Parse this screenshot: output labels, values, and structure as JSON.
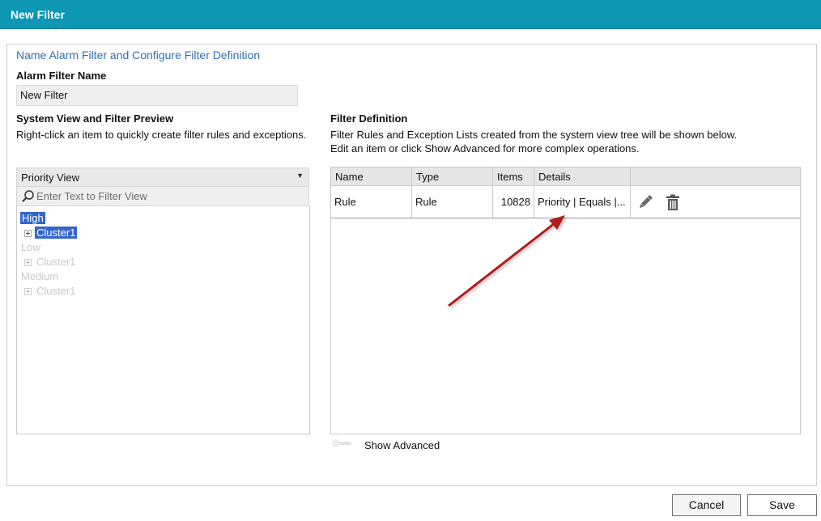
{
  "window": {
    "title": "New Filter"
  },
  "form": {
    "heading": "Name Alarm Filter and Configure Filter Definition",
    "name_label": "Alarm Filter Name",
    "name_value": "New Filter"
  },
  "system_view": {
    "title": "System View and Filter Preview",
    "hint": "Right-click an item to quickly create filter rules and exceptions.",
    "view_select": {
      "value": "Priority View"
    },
    "filter_placeholder": "Enter Text to Filter View",
    "tree": [
      {
        "label": "High",
        "selected": true,
        "dimmed": false
      },
      {
        "label": "Cluster1",
        "selected": true,
        "dimmed": false
      },
      {
        "label": "Low",
        "selected": false,
        "dimmed": true
      },
      {
        "label": "Cluster1",
        "selected": false,
        "dimmed": true
      },
      {
        "label": "Medium",
        "selected": false,
        "dimmed": true
      },
      {
        "label": "Cluster1",
        "selected": false,
        "dimmed": true
      }
    ]
  },
  "filter_definition": {
    "title": "Filter Definition",
    "hint_line1": "Filter Rules and Exception Lists created from the system view tree will be shown below.",
    "hint_line2": "Edit an item or click Show Advanced for more complex operations.",
    "columns": [
      "Name",
      "Type",
      "Items",
      "Details",
      ""
    ],
    "rows": [
      {
        "name": "Rule",
        "type": "Rule",
        "items": "10828",
        "details": "Priority | Equals |..."
      }
    ],
    "show_advanced_label": "Show Advanced"
  },
  "buttons": {
    "cancel": "Cancel",
    "save": "Save"
  },
  "icons": {
    "edit": "pencil-icon",
    "delete": "trash-icon",
    "search": "magnifier-icon",
    "dropdown": "chevron-down-icon",
    "expand": "plus-box-icon"
  },
  "colors": {
    "title_bar": "#0e97b4",
    "heading_text": "#2f6fb5",
    "selection": "#3266cc",
    "annotation_arrow": "#b01c1c"
  }
}
